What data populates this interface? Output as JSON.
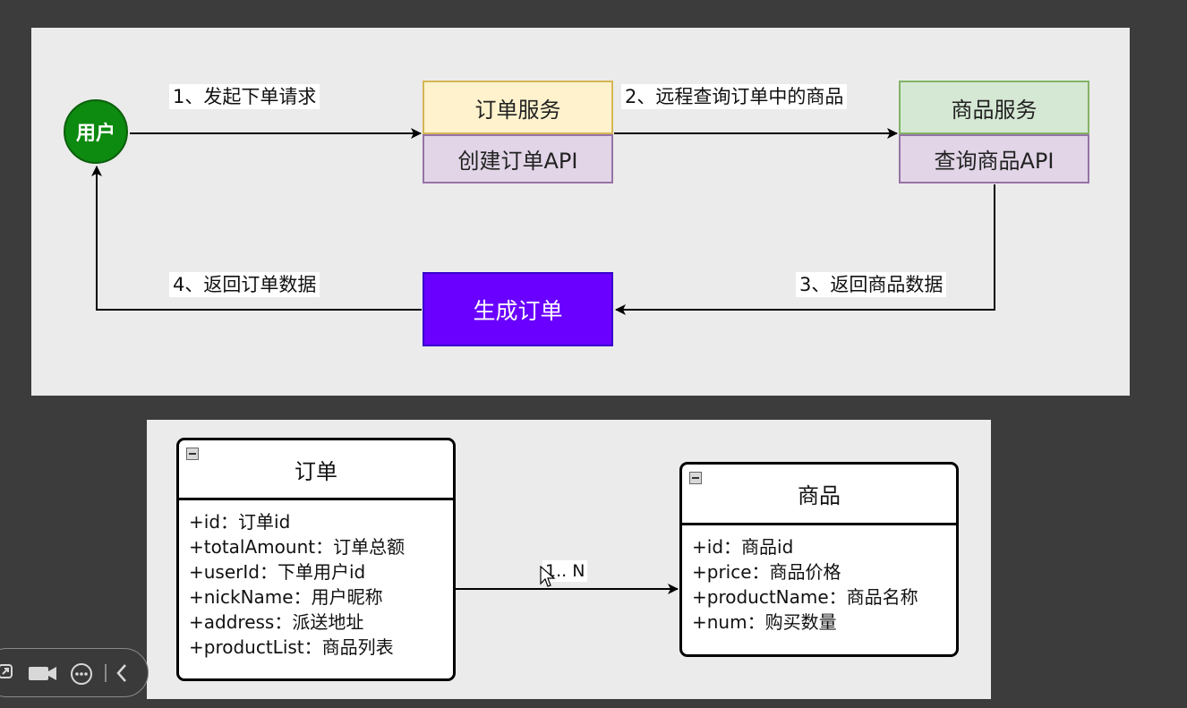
{
  "flow": {
    "user_label": "用户",
    "step1": "1、发起下单请求",
    "step2": "2、远程查询订单中的商品",
    "step3": "3、返回商品数据",
    "step4": "4、返回订单数据",
    "order_service": {
      "title": "订单服务",
      "api": "创建订单API"
    },
    "product_service": {
      "title": "商品服务",
      "api": "查询商品API"
    },
    "generate_order": "生成订单"
  },
  "uml": {
    "order": {
      "title": "订单",
      "fields": [
        "+id：订单id",
        "+totalAmount：订单总额",
        "+userId：下单用户id",
        "+nickName：用户昵称",
        "+address：派送地址",
        "+productList：商品列表"
      ]
    },
    "product": {
      "title": "商品",
      "fields": [
        "+id：商品id",
        "+price：商品价格",
        "+productName：商品名称",
        "+num：购买数量"
      ]
    },
    "multiplicity": "1.. N"
  },
  "toolbar": {
    "icons": [
      "screen-share-icon",
      "camera-icon",
      "more-icon",
      "collapse-arrow-icon"
    ]
  },
  "colors": {
    "user": "#0d8a10",
    "order_service": "#fff2cc",
    "product_service": "#d5e8d4",
    "api": "#e1d5e7",
    "generate": "#6a00ff"
  }
}
